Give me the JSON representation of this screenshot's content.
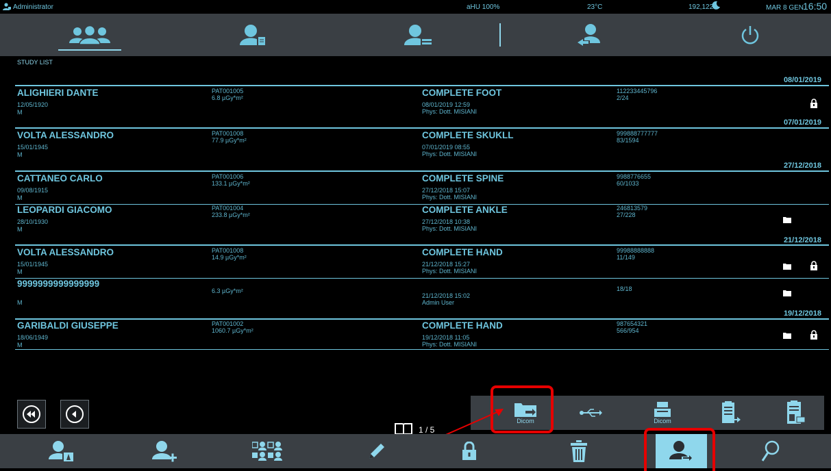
{
  "status": {
    "user": "Administrator",
    "tube": "aHU 100%",
    "temp": "23°C",
    "counter": "192,122",
    "datetime_prefix": "MAR 8 GEN",
    "time": "16:50"
  },
  "section_title": "STUDY LIST",
  "date_headers": [
    "08/01/2019",
    "07/01/2019",
    "27/12/2018",
    "21/12/2018",
    "19/12/2018"
  ],
  "studies": [
    {
      "name": "ALIGHIERI DANTE",
      "dob": "12/05/1920",
      "sex": "M",
      "patient_id": "PAT001005",
      "dose": "6.8 µGy*m²",
      "study": "COMPLETE FOOT",
      "study_datetime": "08/01/2019 12:59",
      "physician": "Phys: Dott. MISIANI",
      "accession": "112233445796",
      "images": "2/24"
    },
    {
      "name": "VOLTA ALESSANDRO",
      "dob": "15/01/1945",
      "sex": "M",
      "patient_id": "PAT001008",
      "dose": "77.9 µGy*m²",
      "study": "COMPLETE SKUKLL",
      "study_datetime": "07/01/2019 08:55",
      "physician": "Phys: Dott. MISIANI",
      "accession": "999888777777",
      "images": "83/1594"
    },
    {
      "name": "CATTANEO CARLO",
      "dob": "09/08/1915",
      "sex": "M",
      "patient_id": "PAT001006",
      "dose": "133.1 µGy*m²",
      "study": "COMPLETE SPINE",
      "study_datetime": "27/12/2018 15:07",
      "physician": "Phys: Dott. MISIANI",
      "accession": "9988776655",
      "images": "60/1033"
    },
    {
      "name": "LEOPARDI GIACOMO",
      "dob": "28/10/1930",
      "sex": "M",
      "patient_id": "PAT001004",
      "dose": "233.8 µGy*m²",
      "study": "COMPLETE ANKLE",
      "study_datetime": "27/12/2018 10:38",
      "physician": "Phys: Dott. MISIANI",
      "accession": "246813579",
      "images": "27/228"
    },
    {
      "name": "VOLTA ALESSANDRO",
      "dob": "15/01/1945",
      "sex": "M",
      "patient_id": "PAT001008",
      "dose": "14.9 µGy*m²",
      "study": "COMPLETE HAND",
      "study_datetime": "21/12/2018 15:27",
      "physician": "Phys: Dott. MISIANI",
      "accession": "99988888888",
      "images": "11/149"
    },
    {
      "name": "9999999999999999",
      "dob": "",
      "sex": "M",
      "patient_id": "",
      "dose": "6.3 µGy*m²",
      "study": "",
      "study_datetime": "21/12/2018 15:02",
      "physician": "Admin User",
      "accession": "",
      "images": "18/18"
    },
    {
      "name": "GARIBALDI GIUSEPPE",
      "dob": "18/06/1949",
      "sex": "M",
      "patient_id": "PAT001002",
      "dose": "1060.7 µGy*m²",
      "study": "COMPLETE HAND",
      "study_datetime": "19/12/2018 11:05",
      "physician": "Phys: Dott. MISIANI",
      "accession": "987654321",
      "images": "566/954"
    }
  ],
  "pager": {
    "page": "1 / 5"
  },
  "export": {
    "dicom_folder_label": "Dicom",
    "dicom_print_label": "Dicom"
  },
  "colors": {
    "accent": "#6fc6df",
    "panel": "#3a3f44",
    "highlight": "#e60000"
  }
}
